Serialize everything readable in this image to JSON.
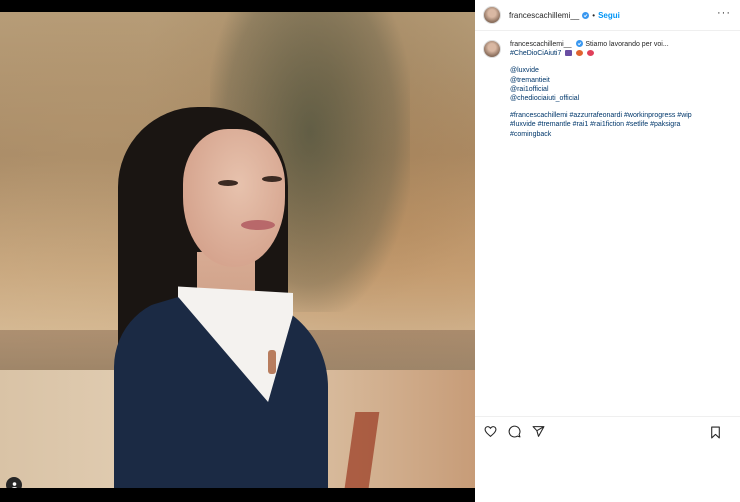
{
  "post": {
    "username": "francescachillemi__",
    "follow_label": "Segui",
    "separator": "•",
    "more_label": "···"
  },
  "caption": {
    "username": "francescachillemi__",
    "text": "Stiamo lavorando per voi...",
    "line2": "#CheDioCiAiuti7",
    "mentions": [
      "@luxvide",
      "@tremantieit",
      "@rai1official",
      "@chediociaiuti_official"
    ],
    "hashtags_line1": "#francescachillemi #azzurrafeonardi #workinprogress #wip",
    "hashtags_line2": "#luxvide #tremantle #rai1 #rai1fiction #setlife #paksigra",
    "hashtags_line3": "#comingback"
  },
  "icons": {
    "like": "heart-icon",
    "comment": "comment-icon",
    "share": "share-icon",
    "save": "bookmark-icon",
    "tags": "user-tag-icon",
    "verified": "verified-badge-icon"
  },
  "colors": {
    "link": "#00376b",
    "follow": "#0095f6",
    "verified": "#3897f0"
  }
}
